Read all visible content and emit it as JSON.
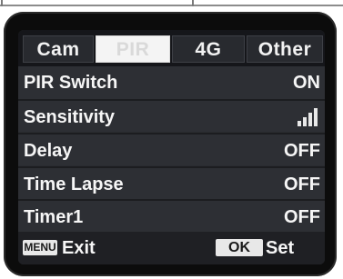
{
  "tabs": [
    {
      "label": "Cam",
      "active": false
    },
    {
      "label": "PIR",
      "active": true
    },
    {
      "label": "4G",
      "active": false
    },
    {
      "label": "Other",
      "active": false
    }
  ],
  "settings": [
    {
      "label": "PIR Switch",
      "value": "ON"
    },
    {
      "label": "Sensitivity",
      "value": "",
      "level_icon": "signal-strength-icon"
    },
    {
      "label": "Delay",
      "value": "OFF"
    },
    {
      "label": "Time Lapse",
      "value": "OFF"
    },
    {
      "label": "Timer1",
      "value": "OFF"
    }
  ],
  "footer": {
    "menu_key": "MENU",
    "menu_action": "Exit",
    "ok_key": "OK",
    "ok_action": "Set"
  },
  "colors": {
    "screen_bg": "#2a2c30",
    "active_tab_bg": "#f4f4f4",
    "text": "#f6f6f6"
  }
}
